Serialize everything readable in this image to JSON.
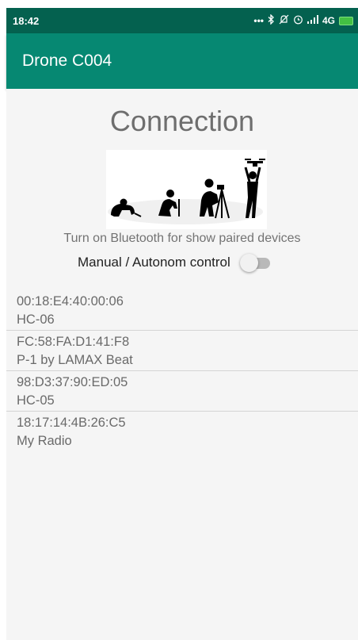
{
  "status_bar": {
    "time": "18:42",
    "icons": [
      "more-icon",
      "bluetooth-icon",
      "silent-icon",
      "alarm-icon",
      "signal-icon"
    ],
    "network": "4G"
  },
  "app_bar": {
    "title": "Drone C004"
  },
  "main": {
    "heading": "Connection",
    "hint": "Turn on Bluetooth for show paired devices",
    "mode_label": "Manual / Autonom control",
    "mode_switch_on": false
  },
  "devices": [
    {
      "address": "00:18:E4:40:00:06",
      "name": "HC-06"
    },
    {
      "address": "FC:58:FA:D1:41:F8",
      "name": "P-1 by LAMAX Beat"
    },
    {
      "address": "98:D3:37:90:ED:05",
      "name": "HC-05"
    },
    {
      "address": "18:17:14:4B:26:C5",
      "name": "My Radio"
    }
  ],
  "colors": {
    "status_bar": "#04614f",
    "app_bar": "#068872",
    "content_bg": "#f5f5f5"
  }
}
